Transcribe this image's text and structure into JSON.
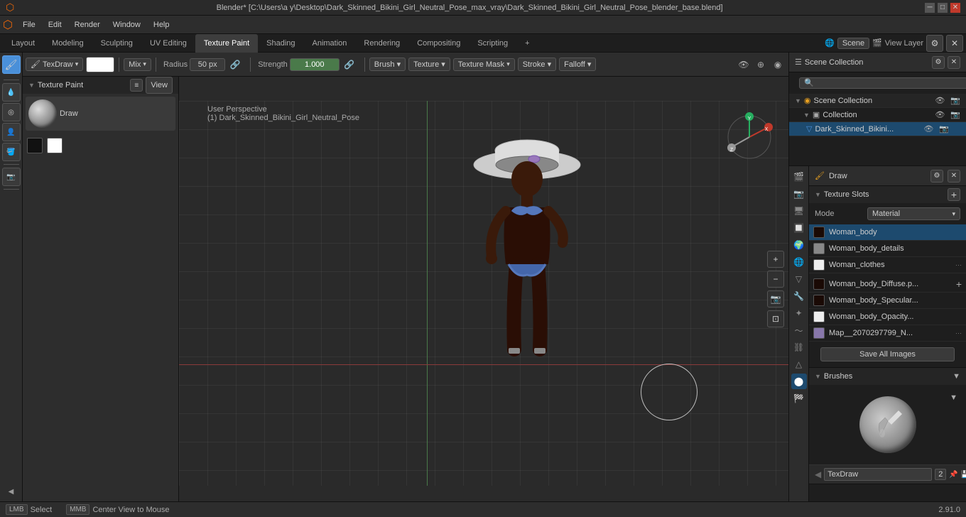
{
  "title_bar": {
    "title": "Blender* [C:\\Users\\a y\\Desktop\\Dark_Skinned_Bikini_Girl_Neutral_Pose_max_vray\\Dark_Skinned_Bikini_Girl_Neutral_Pose_blender_base.blend]",
    "controls": [
      "_",
      "□",
      "×"
    ]
  },
  "menu": {
    "items": [
      "Blender",
      "File",
      "Edit",
      "Render",
      "Window",
      "Help"
    ]
  },
  "workspace_tabs": {
    "tabs": [
      "Layout",
      "Modeling",
      "Sculpting",
      "UV Editing",
      "Texture Paint",
      "Shading",
      "Animation",
      "Rendering",
      "Compositing",
      "Scripting",
      "+"
    ],
    "active": "Texture Paint",
    "scene": "Scene",
    "view_layer": "View Layer"
  },
  "brush_toolbar": {
    "mode_icon": "🖌",
    "mode_label": "TexDraw",
    "color_label": "",
    "blend_label": "Mix",
    "radius_label": "Radius",
    "radius_value": "50 px",
    "strength_label": "Strength",
    "strength_value": "1.000",
    "brush_label": "Brush",
    "brush_dropdown": "Brush ▾",
    "texture_label": "Texture",
    "texture_dropdown": "Texture ▾",
    "texture_mask_label": "Texture Mask",
    "texture_mask_dropdown": "Texture Mask ▾",
    "stroke_label": "Stroke",
    "stroke_dropdown": "Stroke ▾",
    "falloff_label": "Falloff",
    "falloff_dropdown": "Falloff ▾"
  },
  "left_panel": {
    "header": "Texture Paint",
    "view_btn": "View",
    "tools": [
      "cursor",
      "dot",
      "person",
      "bucket",
      "stamp",
      "camera",
      "grid"
    ]
  },
  "viewport": {
    "perspective": "User Perspective",
    "object_name": "(1) Dark_Skinned_Bikini_Girl_Neutral_Pose"
  },
  "outliner": {
    "title": "Scene Collection",
    "search_placeholder": "🔍",
    "scene_collection": "Scene Collection",
    "collection": "Collection",
    "model_name": "Dark_Skinned_Bikini..."
  },
  "texture_slots": {
    "title": "Texture Slots",
    "mode_label": "Mode",
    "mode_value": "Material",
    "slots": [
      {
        "name": "Woman_body",
        "color": "dark",
        "selected": true
      },
      {
        "name": "Woman_body_details",
        "color": "gray"
      },
      {
        "name": "Woman_clothes",
        "color": "white"
      }
    ],
    "images": [
      {
        "name": "Woman_body_Diffuse.p...",
        "color": "dark"
      },
      {
        "name": "Woman_body_Specular...",
        "color": "dark"
      },
      {
        "name": "Woman_body_Opacity...",
        "color": "white"
      },
      {
        "name": "Map__2070297799_N...",
        "color": "purple"
      }
    ],
    "save_all_label": "Save All Images"
  },
  "brushes": {
    "title": "Brushes",
    "brush_name": "TexDraw",
    "brush_number": "2"
  },
  "status_bar": {
    "select_label": "Select",
    "center_view_label": "Center View to Mouse",
    "version": "2.91.0"
  },
  "prop_icons": {
    "icons": [
      "scene",
      "render",
      "output",
      "view_layer",
      "scene_props",
      "world",
      "object",
      "modifier",
      "particles",
      "physics",
      "constraints",
      "object_data",
      "material",
      "texture",
      "light"
    ]
  }
}
